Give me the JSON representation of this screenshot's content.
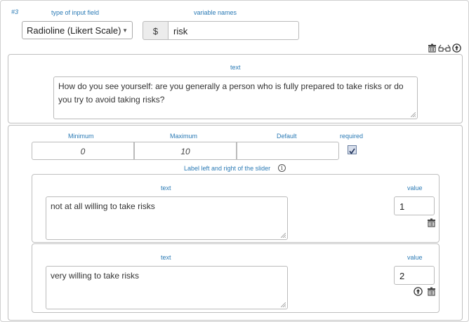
{
  "field_number": "#3",
  "labels": {
    "type_of_input_field": "type of input field",
    "variable_names": "variable names",
    "text": "text",
    "minimum": "Minimum",
    "maximum": "Maximum",
    "default": "Default",
    "required": "required",
    "slider_labels": "Label left and right of the slider",
    "value": "value"
  },
  "input_type": {
    "selected": "Radioline (Likert Scale)",
    "caret": "▼"
  },
  "variable": {
    "prefix": "$",
    "name": "risk"
  },
  "question": {
    "text": "How do you see yourself: are you generally a person who is fully prepared to take risks or do you try to avoid taking risks?"
  },
  "settings": {
    "minimum": "0",
    "maximum": "10",
    "default": "",
    "required": true
  },
  "slider_labels": [
    {
      "text": "not at all willing to take risks",
      "value": "1"
    },
    {
      "text": "very willing to take risks",
      "value": "2"
    }
  ],
  "icons": {
    "delete": "trash-icon",
    "preview": "glasses-icon",
    "move_up": "arrow-up-circle-icon",
    "info": "info-icon"
  },
  "colors": {
    "label_blue": "#2a7ab5",
    "border": "#bfbfbf",
    "checkbox_fill": "#d7deeb"
  }
}
